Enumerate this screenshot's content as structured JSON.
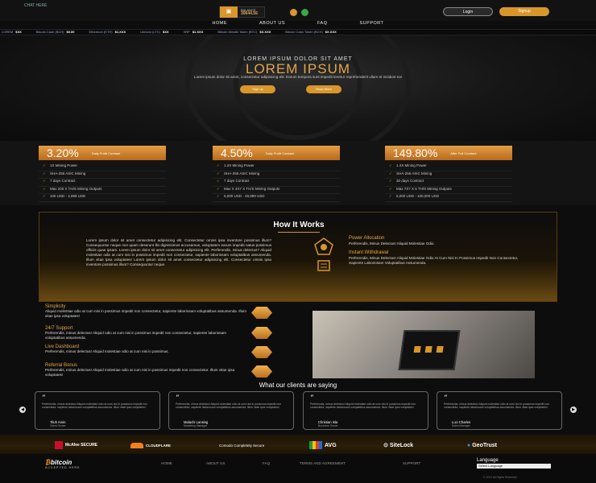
{
  "top": {
    "link": "CHAT HERE",
    "balance_label": "BALANCE",
    "balance_value": "30644.56",
    "login": "Login",
    "signup": "Signup"
  },
  "nav": [
    "HOME",
    "ABOUT US",
    "FAQ",
    "SUPPORT"
  ],
  "ticker": [
    {
      "name": "LOREM",
      "value": "$XX"
    },
    {
      "name": "Bitcoin Cash (BCH)",
      "value": "$0.00"
    },
    {
      "name": "Ethereum (ETH)",
      "value": "$1,XXX"
    },
    {
      "name": "Litecoin (LTC)",
      "value": "$XX"
    },
    {
      "name": "XRP",
      "value": "$1.XXX"
    },
    {
      "name": "Bitcoin Wealth Token (BTC)",
      "value": "$X.XXX"
    },
    {
      "name": "Bitcoin Cash Token (BCH)",
      "value": "$X.XXX"
    }
  ],
  "hero": {
    "kicker": "LOREM IPSUM DOLOR SIT AMET",
    "title": "LOREM IPSUM",
    "sub": "Lorem ipsum dolor sit amet, consectetur adipisicing elit. Earum tempora sunt impedit tenetur reprehenderit ullam et incidunt ea!",
    "btn1": "Sign up",
    "btn2": "Read More"
  },
  "plans": [
    {
      "rate": "3.20%",
      "label": "Daily Profit Contract",
      "items": [
        "1X Mining Power",
        "SHA-256 ASIC Mining",
        "7 days Contract",
        "Max 200 X TH/S Mining Outputs",
        "100 USD - 4,999 USD"
      ]
    },
    {
      "rate": "4.50%",
      "label": "Daily Profit Contract",
      "items": [
        "1.2X Mining Power",
        "SHA-256 ASIC Mining",
        "7 days Contract",
        "Max X 4X7 X TH/S Mining Outputs",
        "5,000 USD - 49,999 USD"
      ]
    },
    {
      "rate": "149.80%",
      "label": "After Full Contract",
      "items": [
        "1.4X Mining Power",
        "SHA-256 ASIC Mining",
        "30 days Contract",
        "Max 7X7 X 6 TH/S Mining Outputs",
        "5,000 USD - 100,000 USD"
      ]
    }
  ],
  "how": {
    "title": "How It Works",
    "text": "Lorem ipsum dolor sit amet consectetur adipisicing elit. Consectetur omnis ipsa inventore possimus illum? Consequuntur neque non quam deserunt illo dignissimos accusamus, voluptatem earum impedit natus possimus officiis quae ipsam. Lorem ipsum dolor sit amet consectetur adipisicing elit. Perferendis, minus delectus? Aliquid molestiae odio at cum nisi in possimus impedit non consectetur, sapiente laboriosam voluptatibus assumenda. Illum vitae ipsa voluptates! Lorem ipsum dolor sit amet consectetur adipisicing elit. Consectetur omnis ipsa inventore possimus illum? Consequuntur neque.",
    "f1_title": "Power Allocation",
    "f1_text": "Perferendis, Minus Delectus! Aliquid Molestiae Odio.",
    "f2_title": "Instant Withdrawal",
    "f2_text": "Perferendis, Minus Delectus! Aliquid Molestiae Odio At Cum Nisi In Possimus Impedit Non Consectetur, Sapiente Laboriosam Voluptatibus Assumenda."
  },
  "features": [
    {
      "title": "Simplicity",
      "text": "Aliquid molestiae odio at cum nisi in possimus impedit non consectetur, sapiente laboriosam voluptatibus assumenda. Illum vitae ipsa voluptates!"
    },
    {
      "title": "24/7 Support",
      "text": "Perferendis, minus delectus! Aliquid odio at cum nisi in possimus impedit non consectetur, sapiente laboriosam voluptatibus assumenda."
    },
    {
      "title": "Live Dashboard",
      "text": "Perferendis, minus delectus! Aliquid molestiae odio at cum nisi in possimus."
    },
    {
      "title": "Referral Bonus",
      "text": "Perferendis, minus delectus! Aliquid molestiae odio at cum nisi in possimus impedit non consectetur. Illum vitae ipsa voluptates!"
    }
  ],
  "testimonials": {
    "title": "What our clients are saying",
    "cards": [
      {
        "text": "Perferendis, minus delectus! Aliquid molestiae odio at cum nisi in possimus impedit non consectetur, sapiente laboriosam voluptatibus assumenda. Illum vitae ipsa voluptates!",
        "name": "Tiluh Amin",
        "role": "Client Owner"
      },
      {
        "text": "Perferendis, minus delectus! Aliquid molestiae odio at cum nisi in possimus impedit non consectetur, sapiente laboriosam voluptatibus assumenda. Illum vitae ipsa voluptates!",
        "name": "Malachi Lansing",
        "role": "Marketing Manager"
      },
      {
        "text": "Perferendis, minus delectus! Aliquid molestiae odio at cum nisi in possimus impedit non consectetur, sapiente laboriosam voluptatibus assumenda. Illum vitae ipsa voluptates!",
        "name": "Christian Isla",
        "role": "Business Owner"
      },
      {
        "text": "Perferendis, minus delectus! Aliquid molestiae odio at cum nisi in possimus impedit non consectetur, sapiente laboriosam voluptatibus assumenda. Illum vitae ipsa voluptates!",
        "name": "Luci Charles",
        "role": "Sales Manager"
      }
    ]
  },
  "security": [
    "McAfee SECURE",
    "CLOUDFLARE",
    "Comodo Completely Secure",
    "AVG",
    "SiteLock",
    "GeoTrust"
  ],
  "footer": {
    "btc": "bitcoin",
    "btc_sub": "ACCEPTED HERE",
    "links": [
      "HOME",
      "ABOUT US",
      "FAQ",
      "TERMS AND AGREEMENT",
      "SUPPORT"
    ],
    "language": "Language",
    "lang_value": "Select Language",
    "copyright": "© 2021 All Rights Reserved"
  },
  "colors": {
    "accent": "#d9962a",
    "bg": "#0d0d0d"
  }
}
